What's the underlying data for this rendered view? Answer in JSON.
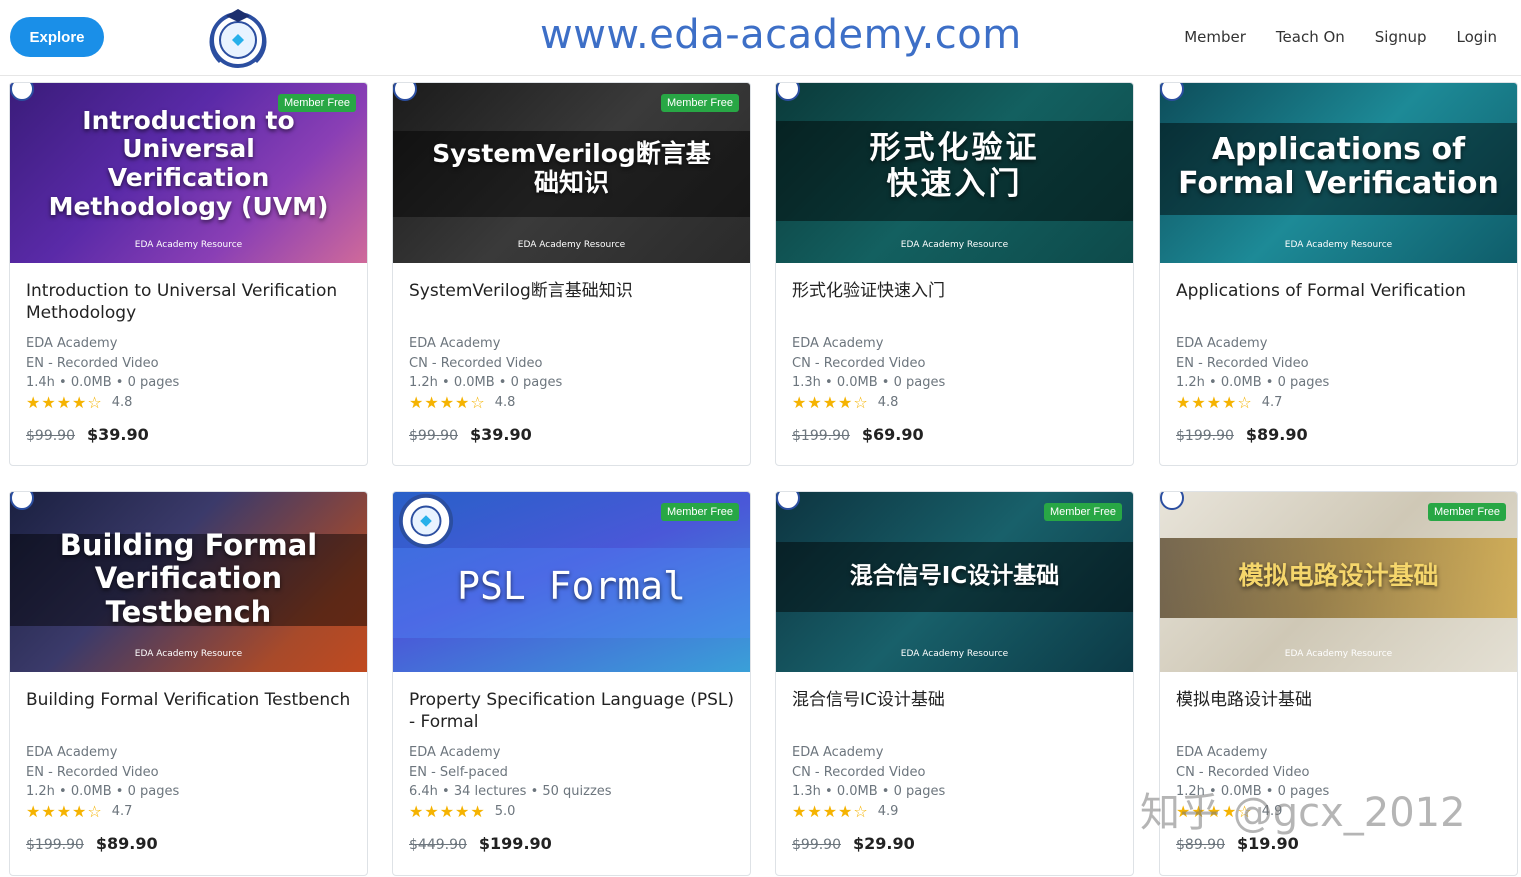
{
  "header": {
    "explore_label": "Explore",
    "site_url": "www.eda-academy.com",
    "nav": [
      "Member",
      "Teach On",
      "Signup",
      "Login"
    ]
  },
  "courses": [
    {
      "thumb_title": "Introduction to Universal Verification Methodology (UVM)",
      "thumb_sub": "EDA Academy Resource",
      "badge": "Member Free",
      "title": "Introduction to Universal Verification Methodology",
      "provider": "EDA Academy",
      "lang_type": "EN - Recorded Video",
      "stats": "1.4h • 0.0MB • 0 pages",
      "stars": "★★★★☆",
      "rating": "4.8",
      "old_price": "$99.90",
      "price": "$39.90"
    },
    {
      "thumb_title": "SystemVerilog断言基础知识",
      "thumb_sub": "EDA Academy Resource",
      "badge": "Member Free",
      "title": "SystemVerilog断言基础知识",
      "provider": "EDA Academy",
      "lang_type": "CN - Recorded Video",
      "stats": "1.2h • 0.0MB • 0 pages",
      "stars": "★★★★☆",
      "rating": "4.8",
      "old_price": "$99.90",
      "price": "$39.90"
    },
    {
      "thumb_title": "形式化验证快速入门",
      "thumb_sub": "EDA Academy Resource",
      "badge": "",
      "title": "形式化验证快速入门",
      "provider": "EDA Academy",
      "lang_type": "CN - Recorded Video",
      "stats": "1.3h • 0.0MB • 0 pages",
      "stars": "★★★★☆",
      "rating": "4.8",
      "old_price": "$199.90",
      "price": "$69.90"
    },
    {
      "thumb_title": "Applications of Formal Verification",
      "thumb_sub": "EDA Academy Resource",
      "badge": "",
      "title": "Applications of Formal Verification",
      "provider": "EDA Academy",
      "lang_type": "EN - Recorded Video",
      "stats": "1.2h • 0.0MB • 0 pages",
      "stars": "★★★★☆",
      "rating": "4.7",
      "old_price": "$199.90",
      "price": "$89.90"
    },
    {
      "thumb_title": "Building Formal Verification Testbench",
      "thumb_sub": "EDA Academy Resource",
      "badge": "",
      "title": "Building Formal Verification Testbench",
      "provider": "EDA Academy",
      "lang_type": "EN - Recorded Video",
      "stats": "1.2h • 0.0MB • 0 pages",
      "stars": "★★★★☆",
      "rating": "4.7",
      "old_price": "$199.90",
      "price": "$89.90"
    },
    {
      "thumb_title": "PSL Formal",
      "thumb_sub": "",
      "badge": "Member Free",
      "title": "Property Specification Language (PSL) - Formal",
      "provider": "EDA Academy",
      "lang_type": "EN - Self-paced",
      "stats": "6.4h • 34 lectures • 50 quizzes",
      "stars": "★★★★★",
      "rating": "5.0",
      "old_price": "$449.90",
      "price": "$199.90"
    },
    {
      "thumb_title": "混合信号IC设计基础",
      "thumb_sub": "EDA Academy Resource",
      "badge": "Member Free",
      "title": "混合信号IC设计基础",
      "provider": "EDA Academy",
      "lang_type": "CN - Recorded Video",
      "stats": "1.3h • 0.0MB • 0 pages",
      "stars": "★★★★☆",
      "rating": "4.9",
      "old_price": "$99.90",
      "price": "$29.90"
    },
    {
      "thumb_title": "模拟电路设计基础",
      "thumb_sub": "EDA Academy Resource",
      "badge": "Member Free",
      "title": "模拟电路设计基础",
      "provider": "EDA Academy",
      "lang_type": "CN - Recorded Video",
      "stats": "1.2h • 0.0MB • 0 pages",
      "stars": "★★★★☆",
      "rating": "4.9",
      "old_price": "$89.90",
      "price": "$19.90"
    }
  ],
  "watermark": "知乎 @gcx_2012",
  "colors": {
    "accent": "#1a8fe8",
    "badge": "#28a745",
    "star": "#f5b301",
    "url_text": "#3d6fc7"
  }
}
